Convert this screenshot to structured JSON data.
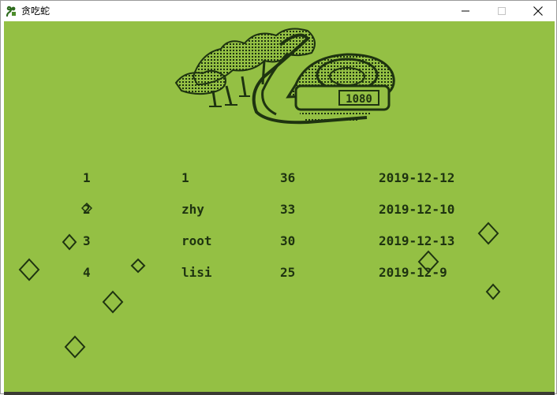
{
  "window": {
    "title": "贪吃蛇",
    "app_icon": "snake-icon",
    "buttons": {
      "minimize_icon": "minimize-icon",
      "maximize_icon": "maximize-icon",
      "close_icon": "close-icon"
    }
  },
  "game": {
    "background_color": "#94c044",
    "ink_color": "#1e3310",
    "logo": {
      "icon": "snake-logo-icon",
      "display_text": "1080"
    },
    "leaderboard": [
      {
        "rank": "1",
        "name": "1",
        "score": "36",
        "date": "2019-12-12"
      },
      {
        "rank": "2",
        "name": "zhy",
        "score": "33",
        "date": "2019-12-10"
      },
      {
        "rank": "3",
        "name": "root",
        "score": "30",
        "date": "2019-12-13"
      },
      {
        "rank": "4",
        "name": "lisi",
        "score": "25",
        "date": "2019-12-9"
      }
    ],
    "food_icon": "diamond-food-icon"
  }
}
